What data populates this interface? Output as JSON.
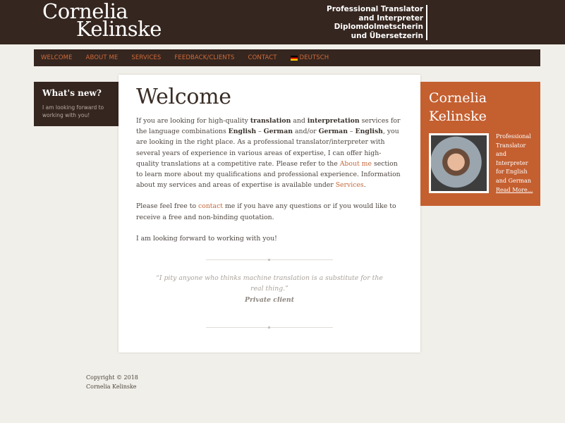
{
  "header": {
    "logo_line1": "Cornelia",
    "logo_line2": "Kelinske",
    "tagline": [
      "Professional Translator",
      "and Interpreter",
      "Diplomdolmetscherin",
      "und Übersetzerin"
    ]
  },
  "nav": {
    "items": [
      "WELCOME",
      "ABOUT ME",
      "SERVICES",
      "FEEDBACK/CLIENTS",
      "CONTACT",
      "DEUTSCH"
    ]
  },
  "sidebar": {
    "title": "What's new?",
    "text": "I am looking forward to working with you!"
  },
  "main": {
    "title": "Welcome",
    "p1": {
      "t1": "If you are looking for high-quality ",
      "b1": "translation",
      "t2": " and ",
      "b2": "interpretation",
      "t3": " services for the language combinations ",
      "b3": "English",
      "t4": " – ",
      "b4": "German",
      "t5": " and/or ",
      "b5": "German",
      "t6": " – ",
      "b6": "English",
      "t7": ", you are looking in the right place. As a professional translator/interpreter with several years of experience in various areas of expertise, I can offer high-quality translations at a competitive rate. Please refer to the ",
      "link1": "About me",
      "t8": " section to learn more about my qualifications and professional experience. Information about my services and areas of expertise is available under ",
      "link2": "Services",
      "t9": "."
    },
    "p2": {
      "t1": "Please feel free to ",
      "link": "contact",
      "t2": " me if you have any questions or if you would like to receive a free and non-binding quotation."
    },
    "p3": "I am looking forward to working with you!",
    "quote": "“I pity anyone who thinks machine translation  is a substitute for the real thing.”",
    "quote_author": "Private client"
  },
  "profile": {
    "name_line1": "Cornelia",
    "name_line2": "Kelinske",
    "desc": "Professional Translator and Interpreter for English and German",
    "more": "Read More..."
  },
  "footer": {
    "line1": "Copyright © 2018",
    "line2": "Cornelia Kelinske"
  },
  "colors": {
    "dark": "#35261f",
    "accent": "#c45f30",
    "link": "#c4673a",
    "nav_text": "#d06a3a"
  },
  "icons": {
    "language_flag": "german-flag-icon"
  }
}
